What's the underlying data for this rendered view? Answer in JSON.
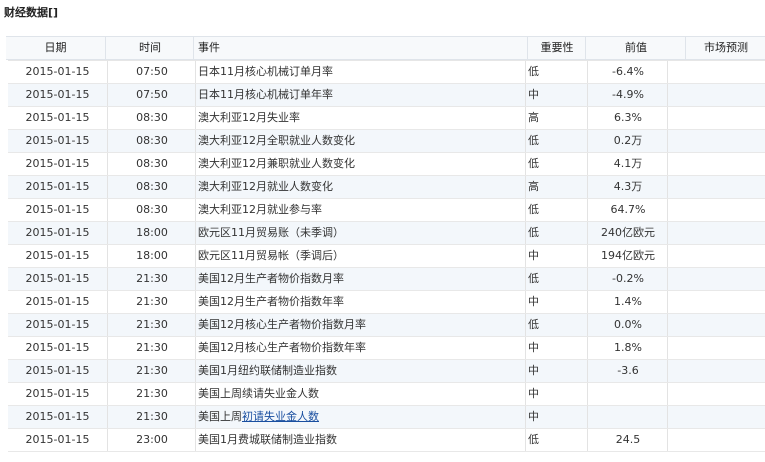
{
  "title": "财经数据[]",
  "headers": {
    "date": "日期",
    "time": "时间",
    "event": "事件",
    "importance": "重要性",
    "previous": "前值",
    "forecast": "市场预测"
  },
  "rows": [
    {
      "date": "2015-01-15",
      "time": "07:50",
      "event": "日本11月核心机械订单月率",
      "importance": "低",
      "previous": "-6.4%",
      "forecast": ""
    },
    {
      "date": "2015-01-15",
      "time": "07:50",
      "event": "日本11月核心机械订单年率",
      "importance": "中",
      "previous": "-4.9%",
      "forecast": ""
    },
    {
      "date": "2015-01-15",
      "time": "08:30",
      "event": "澳大利亚12月失业率",
      "importance": "高",
      "previous": "6.3%",
      "forecast": ""
    },
    {
      "date": "2015-01-15",
      "time": "08:30",
      "event": "澳大利亚12月全职就业人数变化",
      "importance": "低",
      "previous": "0.2万",
      "forecast": ""
    },
    {
      "date": "2015-01-15",
      "time": "08:30",
      "event": "澳大利亚12月兼职就业人数变化",
      "importance": "低",
      "previous": "4.1万",
      "forecast": ""
    },
    {
      "date": "2015-01-15",
      "time": "08:30",
      "event": "澳大利亚12月就业人数变化",
      "importance": "高",
      "previous": "4.3万",
      "forecast": ""
    },
    {
      "date": "2015-01-15",
      "time": "08:30",
      "event": "澳大利亚12月就业参与率",
      "importance": "低",
      "previous": "64.7%",
      "forecast": ""
    },
    {
      "date": "2015-01-15",
      "time": "18:00",
      "event": "欧元区11月贸易账（未季调）",
      "importance": "低",
      "previous": "240亿欧元",
      "forecast": ""
    },
    {
      "date": "2015-01-15",
      "time": "18:00",
      "event": "欧元区11月贸易帐（季调后）",
      "importance": "中",
      "previous": "194亿欧元",
      "forecast": ""
    },
    {
      "date": "2015-01-15",
      "time": "21:30",
      "event": "美国12月生产者物价指数月率",
      "importance": "低",
      "previous": "-0.2%",
      "forecast": ""
    },
    {
      "date": "2015-01-15",
      "time": "21:30",
      "event": "美国12月生产者物价指数年率",
      "importance": "中",
      "previous": "1.4%",
      "forecast": ""
    },
    {
      "date": "2015-01-15",
      "time": "21:30",
      "event": "美国12月核心生产者物价指数月率",
      "importance": "低",
      "previous": "0.0%",
      "forecast": ""
    },
    {
      "date": "2015-01-15",
      "time": "21:30",
      "event": "美国12月核心生产者物价指数年率",
      "importance": "中",
      "previous": "1.8%",
      "forecast": ""
    },
    {
      "date": "2015-01-15",
      "time": "21:30",
      "event": "美国1月纽约联储制造业指数",
      "importance": "中",
      "previous": "-3.6",
      "forecast": ""
    },
    {
      "date": "2015-01-15",
      "time": "21:30",
      "event": "美国上周续请失业金人数",
      "importance": "中",
      "previous": "",
      "forecast": ""
    },
    {
      "date": "2015-01-15",
      "time": "21:30",
      "event_prefix": "美国上周",
      "event_link": "初请失业金人数",
      "importance": "中",
      "previous": "",
      "forecast": ""
    },
    {
      "date": "2015-01-15",
      "time": "23:00",
      "event": "美国1月费城联储制造业指数",
      "importance": "低",
      "previous": "24.5",
      "forecast": ""
    }
  ]
}
